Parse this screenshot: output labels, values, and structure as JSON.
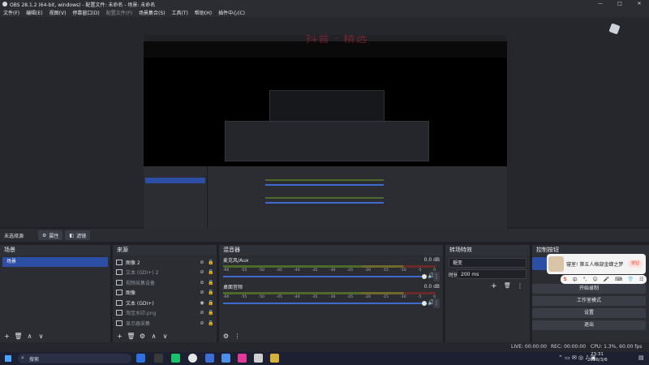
{
  "window": {
    "title": "OBS 28.1.2 (64-bit, windows) - 配置文件: 未命名 - 场景: 未命名",
    "minimize": "—",
    "maximize": "□",
    "close": "✕"
  },
  "menu": [
    "文件(F)",
    "编辑(E)",
    "视图(V)",
    "停靠窗口(D)",
    "配置文件(P)",
    "场景集合(S)",
    "工具(T)",
    "帮助(H)",
    "插件中心(C)"
  ],
  "preview": {
    "watermark": "抖音 · 精选"
  },
  "scene_bar": {
    "no_source": "未选择源",
    "properties": "属性",
    "filters": "滤镜"
  },
  "scenes": {
    "header": "场景",
    "items": [
      "场景"
    ]
  },
  "sources": {
    "header": "来源",
    "items": [
      {
        "label": "图像 2",
        "dim": false
      },
      {
        "label": "文本 (GDI+) 2",
        "dim": true
      },
      {
        "label": "视频采集设备",
        "dim": true
      },
      {
        "label": "图像",
        "dim": false
      },
      {
        "label": "文本 (GDI+)",
        "dim": false
      },
      {
        "label": "淘宝水印.png",
        "dim": true
      },
      {
        "label": "显示器采集",
        "dim": true
      }
    ]
  },
  "mixer": {
    "header": "混音器",
    "scale": [
      "-60",
      "-55",
      "-50",
      "-45",
      "-40",
      "-35",
      "-30",
      "-25",
      "-20",
      "-15",
      "-10",
      "-5",
      "0"
    ],
    "channels": [
      {
        "name": "麦克风/Aux",
        "db": "0.0 dB",
        "volume": 1.0
      },
      {
        "name": "桌面音频",
        "db": "0.0 dB",
        "volume": 1.0
      }
    ]
  },
  "transitions": {
    "header": "转场特效",
    "type": "褪变",
    "duration_label": "时长",
    "duration": "200 ms"
  },
  "controls": {
    "header": "控制按钮",
    "buttons": [
      "开始录制",
      "工作室模式",
      "设置",
      "退出"
    ],
    "popup_text": "寝室! 第五人格部金蝉之梦",
    "popup_button": "按钮"
  },
  "ime_bar": [
    "中",
    "°,",
    "☺",
    "🎤",
    "⌨",
    "👕",
    "☷"
  ],
  "status": {
    "live": "LIVE: 00:00:00",
    "rec": "REC: 00:00:00",
    "cpu": "CPU: 1.3%, 60.00 fps"
  },
  "taskbar": {
    "search": "搜索",
    "time": "23:31",
    "date": "2026/3/6"
  },
  "colors": {
    "accent": "#2c4ea5",
    "panel": "#2b2d33",
    "background": "#1f1f24"
  }
}
